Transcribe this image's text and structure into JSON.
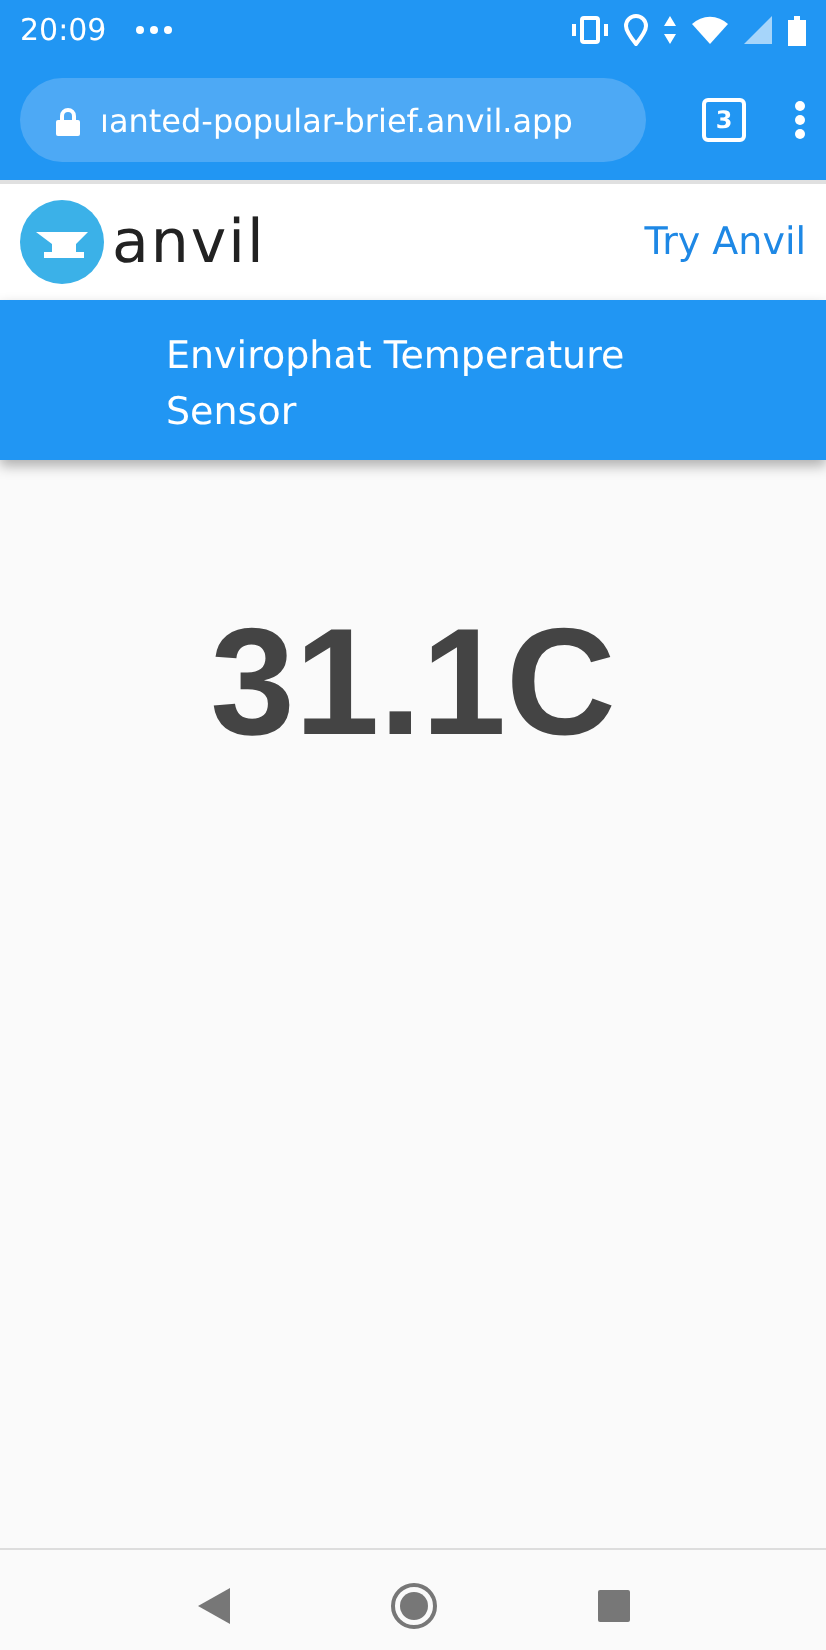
{
  "status_bar": {
    "time": "20:09"
  },
  "browser": {
    "url": "ıanted-popular-brief.anvil.app",
    "tab_count": "3"
  },
  "header": {
    "logo_text": "anvil",
    "link": "Try Anvil"
  },
  "title_bar": {
    "title": "Envirophat Temperature Sensor"
  },
  "reading": {
    "value": "31.1C"
  }
}
